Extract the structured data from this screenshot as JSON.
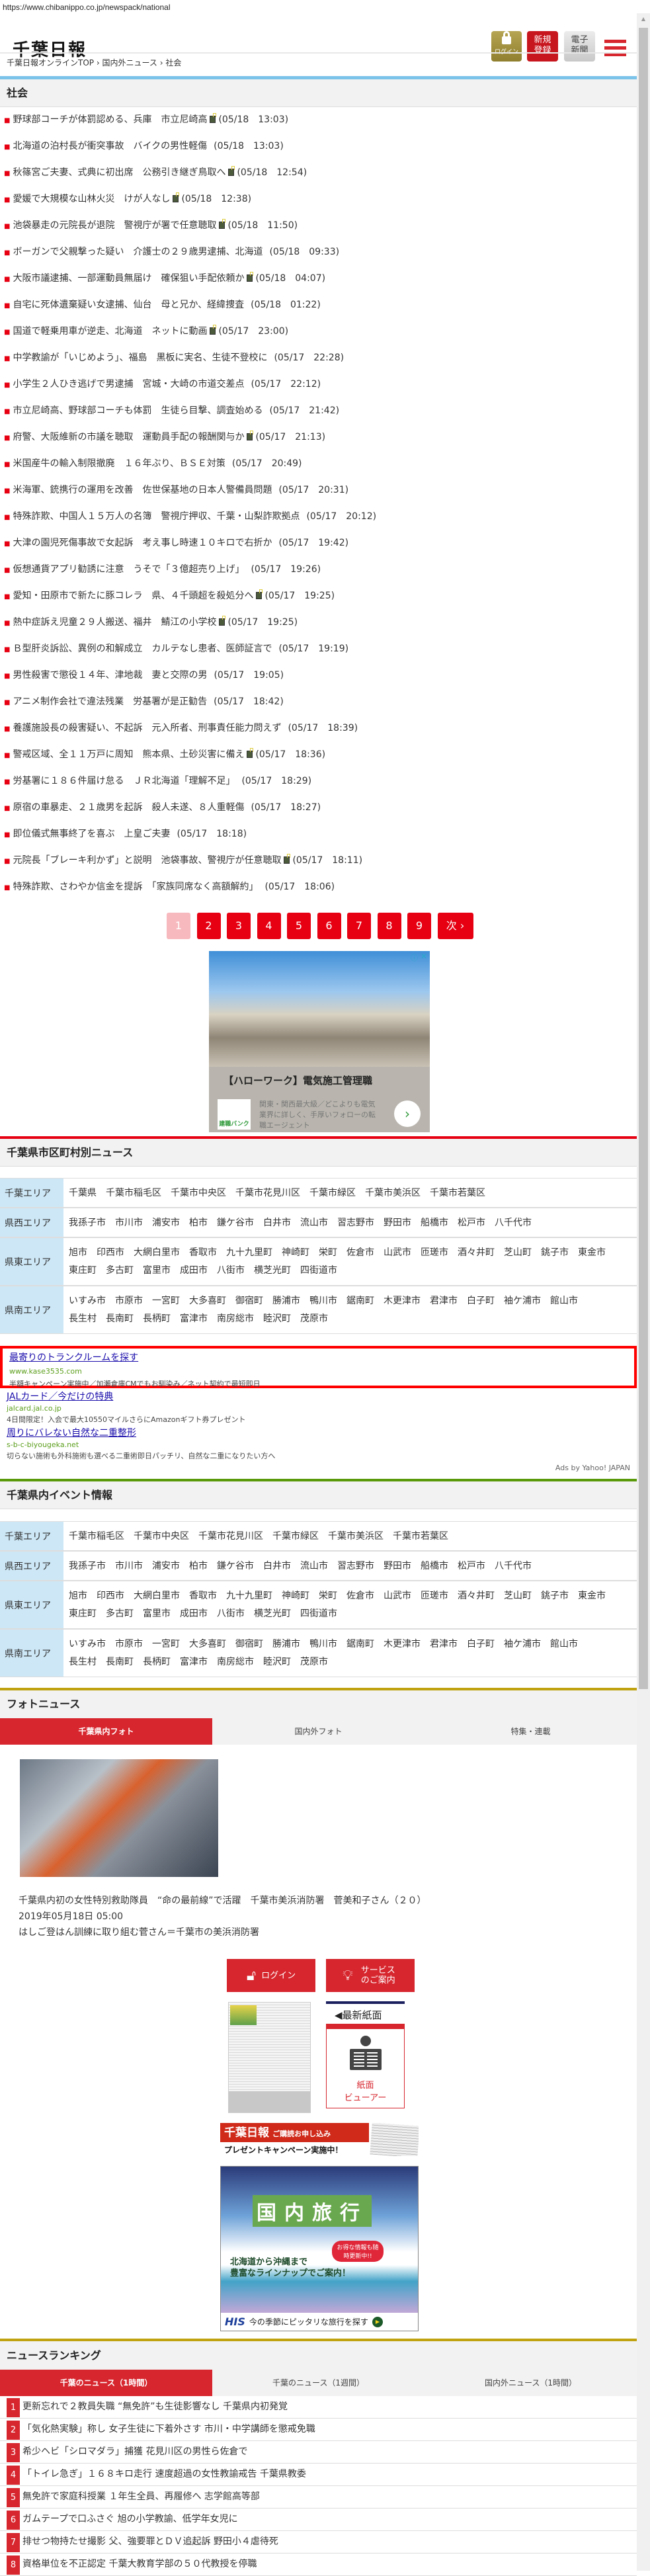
{
  "url": "https://www.chibanippo.co.jp/newspack/national",
  "header": {
    "logo": "千葉日報",
    "login_label": "ログイン",
    "register_label": "新規登録",
    "epaper_label": "電子新聞"
  },
  "breadcrumb": [
    "千葉日報オンラインTOP",
    "国内外ニュース",
    "社会"
  ],
  "breadcrumb_sep": "›",
  "section_title": "社会",
  "news": [
    {
      "title": "野球部コーチが体罰認める、兵庫　市立尼崎高",
      "time": "(05/18　13:03)",
      "locked": true
    },
    {
      "title": "北海道の泊村長が衝突事故　バイクの男性軽傷",
      "time": "(05/18　13:03)",
      "locked": false
    },
    {
      "title": "秋篠宮ご夫妻、式典に初出席　公務引き継ぎ鳥取へ",
      "time": "(05/18　12:54)",
      "locked": true
    },
    {
      "title": "愛媛で大規模な山林火災　けが人なし",
      "time": "(05/18　12:38)",
      "locked": true
    },
    {
      "title": "池袋暴走の元院長が退院　警視庁が署で任意聴取",
      "time": "(05/18　11:50)",
      "locked": true
    },
    {
      "title": "ボーガンで父親撃った疑い　介護士の２９歳男逮捕、北海道",
      "time": "(05/18　09:33)",
      "locked": false
    },
    {
      "title": "大阪市議逮捕、一部運動員無届け　確保狙い手配依頼か",
      "time": "(05/18　04:07)",
      "locked": true
    },
    {
      "title": "自宅に死体遺棄疑い女逮捕、仙台　母と兄か、経緯捜査",
      "time": "(05/18　01:22)",
      "locked": false
    },
    {
      "title": "国道で軽乗用車が逆走、北海道　ネットに動画",
      "time": "(05/17　23:00)",
      "locked": true
    },
    {
      "title": "中学教諭が「いじめよう」、福島　黒板に実名、生徒不登校に",
      "time": "(05/17　22:28)",
      "locked": false
    },
    {
      "title": "小学生２人ひき逃げで男逮捕　宮城・大崎の市道交差点",
      "time": "(05/17　22:12)",
      "locked": false
    },
    {
      "title": "市立尼崎高、野球部コーチも体罰　生徒ら目撃、調査始める",
      "time": "(05/17　21:42)",
      "locked": false
    },
    {
      "title": "府警、大阪維新の市議を聴取　運動員手配の報酬関与か",
      "time": "(05/17　21:13)",
      "locked": true
    },
    {
      "title": "米国産牛の輸入制限撤廃　１６年ぶり、ＢＳＥ対策",
      "time": "(05/17　20:49)",
      "locked": false
    },
    {
      "title": "米海軍、銃携行の運用を改善　佐世保基地の日本人警備員問題",
      "time": "(05/17　20:31)",
      "locked": false
    },
    {
      "title": "特殊詐欺、中国人１５万人の名簿　警視庁押収、千葉・山梨詐欺拠点",
      "time": "(05/17　20:12)",
      "locked": false
    },
    {
      "title": "大津の園児死傷事故で女起訴　考え事し時速１０キロで右折か",
      "time": "(05/17　19:42)",
      "locked": false
    },
    {
      "title": "仮想通貨アプリ勧誘に注意　うそで「３億超売り上げ」",
      "time": "(05/17　19:26)",
      "locked": false
    },
    {
      "title": "愛知・田原市で新たに豚コレラ　県、４千頭超を殺処分へ",
      "time": "(05/17　19:25)",
      "locked": true
    },
    {
      "title": "熱中症訴え児童２９人搬送、福井　鯖江の小学校",
      "time": "(05/17　19:25)",
      "locked": true
    },
    {
      "title": "Ｂ型肝炎訴訟、異例の和解成立　カルテなし患者、医師証言で",
      "time": "(05/17　19:19)",
      "locked": false
    },
    {
      "title": "男性殺害で懲役１４年、津地裁　妻と交際の男",
      "time": "(05/17　19:05)",
      "locked": false
    },
    {
      "title": "アニメ制作会社で違法残業　労基署が是正勧告",
      "time": "(05/17　18:42)",
      "locked": false
    },
    {
      "title": "養護施設長の殺害疑い、不起訴　元入所者、刑事責任能力問えず",
      "time": "(05/17　18:39)",
      "locked": false
    },
    {
      "title": "警戒区域、全１１万戸に周知　熊本県、土砂災害に備え",
      "time": "(05/17　18:36)",
      "locked": true
    },
    {
      "title": "労基署に１８６件届け怠る　ＪＲ北海道「理解不足」",
      "time": "(05/17　18:29)",
      "locked": false
    },
    {
      "title": "原宿の車暴走、２１歳男を起訴　殺人未遂、８人重軽傷",
      "time": "(05/17　18:27)",
      "locked": false
    },
    {
      "title": "即位儀式無事終了を喜ぶ　上皇ご夫妻",
      "time": "(05/17　18:18)",
      "locked": false
    },
    {
      "title": "元院長「ブレーキ利かず」と説明　池袋事故、警視庁が任意聴取",
      "time": "(05/17　18:11)",
      "locked": true
    },
    {
      "title": "特殊詐欺、さわやか信金を提訴　「家族同席なく高額解約」",
      "time": "(05/17　18:06)",
      "locked": false
    }
  ],
  "pagination": {
    "pages": [
      "1",
      "2",
      "3",
      "4",
      "5",
      "6",
      "7",
      "8",
      "9"
    ],
    "current": "1",
    "next": "次 ›"
  },
  "ad_banner": {
    "headline": "【ハローワーク】電気施工管理職",
    "body": "関東・関西最大級／どこよりも電気業界に詳しく、手厚いフォローの転職エージェント",
    "brand": "建職バンク"
  },
  "city_news": {
    "title": "千葉県市区町村別ニュース",
    "areas": [
      {
        "label": "千葉エリア",
        "items": [
          "千葉県",
          "千葉市稲毛区",
          "千葉市中央区",
          "千葉市花見川区",
          "千葉市緑区",
          "千葉市美浜区",
          "千葉市若葉区"
        ]
      },
      {
        "label": "県西エリア",
        "items": [
          "我孫子市",
          "市川市",
          "浦安市",
          "柏市",
          "鎌ケ谷市",
          "白井市",
          "流山市",
          "習志野市",
          "野田市",
          "船橋市",
          "松戸市",
          "八千代市"
        ]
      },
      {
        "label": "県東エリア",
        "items": [
          "旭市",
          "印西市",
          "大網白里市",
          "香取市",
          "九十九里町",
          "神崎町",
          "栄町",
          "佐倉市",
          "山武市",
          "匝瑳市",
          "酒々井町",
          "芝山町",
          "銚子市",
          "東金市",
          "東庄町",
          "多古町",
          "富里市",
          "成田市",
          "八街市",
          "横芝光町",
          "四街道市"
        ]
      },
      {
        "label": "県南エリア",
        "items": [
          "いすみ市",
          "市原市",
          "一宮町",
          "大多喜町",
          "御宿町",
          "勝浦市",
          "鴨川市",
          "鋸南町",
          "木更津市",
          "君津市",
          "白子町",
          "袖ケ浦市",
          "館山市",
          "長生村",
          "長南町",
          "長柄町",
          "富津市",
          "南房総市",
          "睦沢町",
          "茂原市"
        ]
      }
    ]
  },
  "text_ads": [
    {
      "title": "最寄りのトランクルームを探す",
      "url": "www.kase3535.com",
      "desc": "半額キャンペーン実施中／加瀬倉庫CMでもお馴染み／ネット契約で最短即日"
    },
    {
      "title": "JALカード／今だけの特典",
      "url": "jalcard.jal.co.jp",
      "desc": "4日間限定！入会で最大10550マイルさらにAmazonギフト券プレゼント"
    },
    {
      "title": "周りにバレない自然な二重整形",
      "url": "s-b-c-biyougeka.net",
      "desc": "切らない施術も外科施術も選べる二重術即日パッチリ、自然な二重になりたい方へ"
    }
  ],
  "ads_by": "Ads by Yahoo! JAPAN",
  "event_info": {
    "title": "千葉県内イベント情報",
    "areas": [
      {
        "label": "千葉エリア",
        "items": [
          "千葉市稲毛区",
          "千葉市中央区",
          "千葉市花見川区",
          "千葉市緑区",
          "千葉市美浜区",
          "千葉市若葉区"
        ]
      },
      {
        "label": "県西エリア",
        "items": [
          "我孫子市",
          "市川市",
          "浦安市",
          "柏市",
          "鎌ケ谷市",
          "白井市",
          "流山市",
          "習志野市",
          "野田市",
          "船橋市",
          "松戸市",
          "八千代市"
        ]
      },
      {
        "label": "県東エリア",
        "items": [
          "旭市",
          "印西市",
          "大網白里市",
          "香取市",
          "九十九里町",
          "神崎町",
          "栄町",
          "佐倉市",
          "山武市",
          "匝瑳市",
          "酒々井町",
          "芝山町",
          "銚子市",
          "東金市",
          "東庄町",
          "多古町",
          "富里市",
          "成田市",
          "八街市",
          "横芝光町",
          "四街道市"
        ]
      },
      {
        "label": "県南エリア",
        "items": [
          "いすみ市",
          "市原市",
          "一宮町",
          "大多喜町",
          "御宿町",
          "勝浦市",
          "鴨川市",
          "鋸南町",
          "木更津市",
          "君津市",
          "白子町",
          "袖ケ浦市",
          "館山市",
          "長生村",
          "長南町",
          "長柄町",
          "富津市",
          "南房総市",
          "睦沢町",
          "茂原市"
        ]
      }
    ]
  },
  "photo_news": {
    "title": "フォトニュース",
    "tabs": [
      "千葉県内フォト",
      "国内外フォト",
      "特集・連載"
    ],
    "active_tab": 0,
    "headline": "千葉県内初の女性特別救助隊員　“命の最前線”で活躍　千葉市美浜消防署　菅美和子さん（２０）",
    "date": "2019年05月18日 05:00",
    "caption": "はしご登はん訓練に取り組む菅さん＝千葉市の美浜消防署"
  },
  "service": {
    "login_label": "ログイン",
    "service_label": "サービスのご案内",
    "latest_paper": "◀最新紙面",
    "viewer_label1": "紙面",
    "viewer_label2": "ビューアー"
  },
  "subscribe_banner": {
    "logo": "千葉日報",
    "line1": "ご購読お申し込み",
    "line2": "プレゼントキャンペーン実施中！"
  },
  "travel_ad": {
    "headline": "国内旅行",
    "bubble": "お得な情報も随時更新中!!",
    "copy1": "北海道から沖縄まで",
    "copy2": "豊富なラインナップでご案内！",
    "brand": "HIS",
    "cta": "今の季節にピッタリな旅行を探す"
  },
  "ranking": {
    "title": "ニュースランキング",
    "tabs": [
      "千葉のニュース（1時間）",
      "千葉のニュース（1週間）",
      "国内外ニュース（1時間）"
    ],
    "active_tab": 0,
    "items": [
      "更新忘れで２教員失職 “無免許”も生徒影響なし 千葉県内初発覚",
      "「気化熱実験」称し 女子生徒に下着外さす 市川・中学講師を懲戒免職",
      "希少ヘビ「シロマダラ」捕獲 花見川区の男性ら佐倉で",
      "「トイレ急ぎ」１６８キロ走行 速度超過の女性教諭戒告 千葉県教委",
      "無免許で家庭科授業 １年生全員、再履修へ 志学館高等部",
      "ガムテープで口ふさぐ 旭の小学教諭、低学年女児に",
      "排せつ物持たせ撮影 父、強要罪とＤＶ追起訴 野田小４虐待死",
      "資格単位を不正認定 千葉大教育学部の５０代教授を停職"
    ]
  },
  "colors": {
    "brand_red": "#e60012",
    "tab_red": "#d7262e",
    "area_blue": "#cde7f6",
    "line_blue": "#7cc3ea",
    "line_green": "#5a9a0a",
    "line_gold": "#c0a210"
  }
}
